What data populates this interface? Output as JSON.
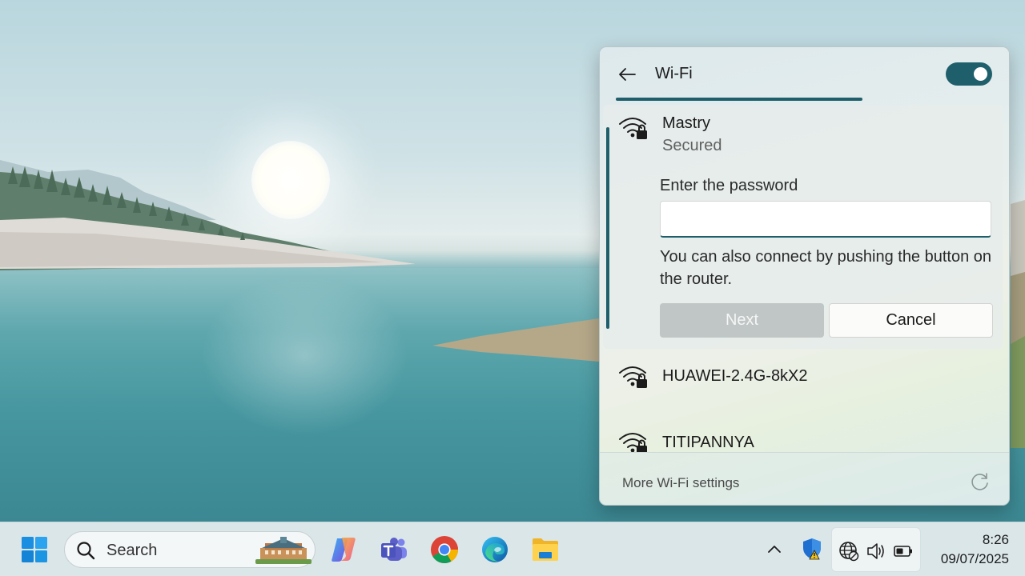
{
  "wifi_panel": {
    "title": "Wi-Fi",
    "toggle_state": "on",
    "accent_color": "#1f5f6b",
    "networks": [
      {
        "name": "Mastry",
        "status": "Secured",
        "icon": "wifi-secured-icon",
        "expanded": true
      },
      {
        "name": "HUAWEI-2.4G-8kX2",
        "icon": "wifi-secured-icon"
      },
      {
        "name": "TITIPANNYA",
        "icon": "wifi-secured-icon"
      }
    ],
    "password_label": "Enter the password",
    "password_value": "",
    "wps_hint": "You can also connect by pushing the button on the router.",
    "next_label": "Next",
    "cancel_label": "Cancel",
    "more_settings_label": "More Wi-Fi settings"
  },
  "taskbar": {
    "start_icon": "windows-start-icon",
    "search_placeholder": "Search",
    "pinned_apps": [
      "copilot-icon",
      "teams-icon",
      "chrome-icon",
      "edge-icon",
      "file-explorer-icon"
    ],
    "tray_icons": [
      "chevron-up-icon",
      "windows-security-icon",
      "network-icon",
      "volume-icon",
      "battery-icon"
    ],
    "time": "8:26",
    "date": "09/07/2025"
  }
}
